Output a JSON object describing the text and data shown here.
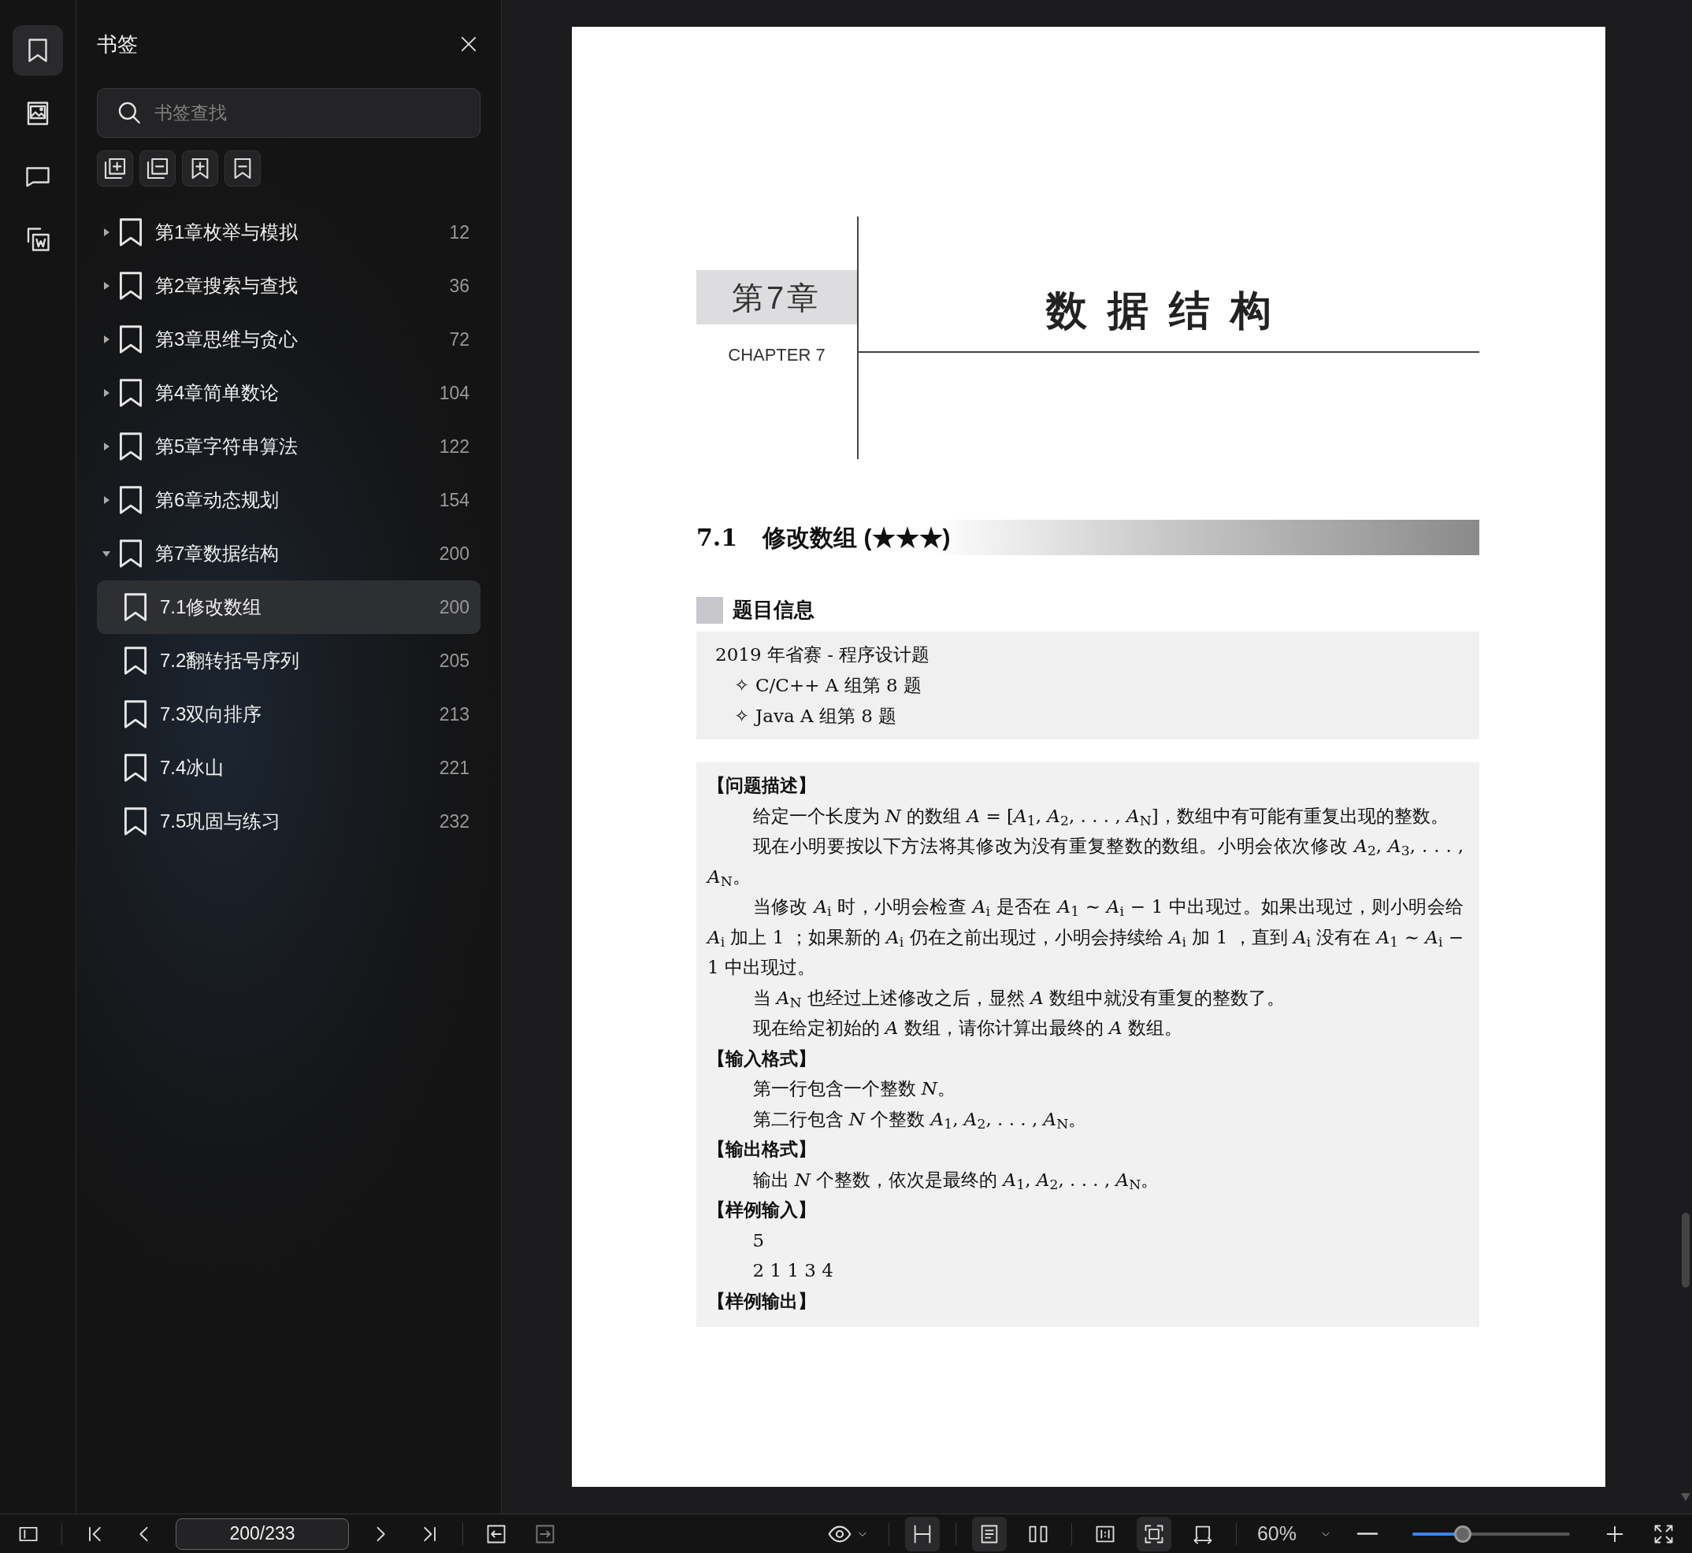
{
  "rail": [
    {
      "kind": "bookmarks",
      "selected": true
    },
    {
      "kind": "thumbnails",
      "selected": false
    },
    {
      "kind": "comments",
      "selected": false
    },
    {
      "kind": "convert",
      "selected": false
    }
  ],
  "sidebar": {
    "title": "书签",
    "search": {
      "placeholder": "书签查找"
    },
    "tools": [
      {
        "kind": "expand_all"
      },
      {
        "kind": "collapse_all"
      },
      {
        "kind": "add_bookmark"
      },
      {
        "kind": "remove_bookmark"
      }
    ]
  },
  "bookmarks": [
    {
      "label": "第1章枚举与模拟",
      "page": "12",
      "expanded": false,
      "selected": false
    },
    {
      "label": "第2章搜索与查找",
      "page": "36",
      "expanded": false,
      "selected": false
    },
    {
      "label": "第3章思维与贪心",
      "page": "72",
      "expanded": false,
      "selected": false
    },
    {
      "label": "第4章简单数论",
      "page": "104",
      "expanded": false,
      "selected": false
    },
    {
      "label": "第5章字符串算法",
      "page": "122",
      "expanded": false,
      "selected": false
    },
    {
      "label": "第6章动态规划",
      "page": "154",
      "expanded": false,
      "selected": false
    },
    {
      "label": "第7章数据结构",
      "page": "200",
      "expanded": true,
      "selected": false,
      "children": [
        {
          "label": "7.1修改数组",
          "page": "200",
          "selected": true
        },
        {
          "label": "7.2翻转括号序列",
          "page": "205",
          "selected": false
        },
        {
          "label": "7.3双向排序",
          "page": "213",
          "selected": false
        },
        {
          "label": "7.4冰山",
          "page": "221",
          "selected": false
        },
        {
          "label": "7.5巩固与练习",
          "page": "232",
          "selected": false
        }
      ]
    }
  ],
  "page": {
    "chapter_label": "第7章",
    "chapter_en": "CHAPTER 7",
    "chapter_title": "数据结构",
    "section": {
      "number": "7.1",
      "title": "修改数组 (★★★)"
    },
    "info_heading": "题目信息",
    "info_lines": [
      {
        "kind": "plain",
        "text": "2019 年省赛 - 程序设计题"
      },
      {
        "kind": "bullet",
        "bullet": "✧",
        "text": "C/C++ A 组第 8 题"
      },
      {
        "kind": "bullet",
        "bullet": "✧",
        "text": "Java A 组第 8 题"
      }
    ],
    "problem": [
      {
        "kind": "heading",
        "text": "【问题描述】"
      },
      {
        "kind": "para",
        "text": "给定一个长度为 *N* 的数组 *A* = [*A*$_{1}$, *A*$_{2}$, . . . , *A*$_{N}$]，数组中有可能有重复出现的整数。"
      },
      {
        "kind": "para",
        "text": "现在小明要按以下方法将其修改为没有重复整数的数组。小明会依次修改 *A*$_{2}$, *A*$_{3}$, . . . , *A*$_{N}$。"
      },
      {
        "kind": "para",
        "text": "当修改 *A*$_{i}$ 时，小明会检查 *A*$_{i}$ 是否在 *A*$_{1}$ ∼ *A*$_{i}$ − 1 中出现过。如果出现过，则小明会给 *A*$_{i}$ 加上 1 ；如果新的 *A*$_{i}$ 仍在之前出现过，小明会持续给 *A*$_{i}$ 加 1 ，直到 *A*$_{i}$ 没有在 *A*$_{1}$ ∼ *A*$_{i}$ − 1 中出现过。"
      },
      {
        "kind": "para",
        "text": "当 *A*$_{N}$ 也经过上述修改之后，显然 *A* 数组中就没有重复的整数了。"
      },
      {
        "kind": "para",
        "text": "现在给定初始的 *A* 数组，请你计算出最终的 *A* 数组。"
      },
      {
        "kind": "heading",
        "text": "【输入格式】"
      },
      {
        "kind": "para",
        "text": "第一行包含一个整数 *N*。"
      },
      {
        "kind": "para",
        "text": "第二行包含 *N* 个整数 *A*$_{1}$, *A*$_{2}$, . . . , *A*$_{N}$。"
      },
      {
        "kind": "heading",
        "text": "【输出格式】"
      },
      {
        "kind": "para",
        "text": "输出 *N* 个整数，依次是最终的 *A*$_{1}$, *A*$_{2}$, . . . , *A*$_{N}$。"
      },
      {
        "kind": "heading",
        "text": "【样例输入】"
      },
      {
        "kind": "para",
        "text": "5"
      },
      {
        "kind": "para",
        "text": "2 1 1 3 4"
      },
      {
        "kind": "heading",
        "text": "【样例输出】"
      }
    ]
  },
  "toolbar": {
    "groups": [
      [
        {
          "kind": "sidebar"
        }
      ],
      [
        {
          "kind": "first"
        },
        {
          "kind": "prev"
        },
        {
          "kind": "page_field",
          "value": "200/233"
        },
        {
          "kind": "next"
        },
        {
          "kind": "last"
        }
      ],
      [
        {
          "kind": "back",
          "disabled": false
        },
        {
          "kind": "forward",
          "disabled": true
        }
      ],
      [
        {
          "kind": "eye"
        }
      ],
      [
        {
          "kind": "scroll",
          "selected": true
        }
      ],
      [
        {
          "kind": "single",
          "selected": true
        },
        {
          "kind": "double",
          "selected": false
        }
      ],
      [
        {
          "kind": "actual",
          "selected": false
        },
        {
          "kind": "fit_page",
          "selected": true
        },
        {
          "kind": "fit_width",
          "selected": false
        }
      ],
      [
        {
          "kind": "zoom_select",
          "value": "60%"
        },
        {
          "kind": "zoom_out"
        },
        {
          "kind": "zoom_slider",
          "level": 0.32
        },
        {
          "kind": "zoom_in"
        },
        {
          "kind": "fullscreen"
        }
      ]
    ]
  }
}
